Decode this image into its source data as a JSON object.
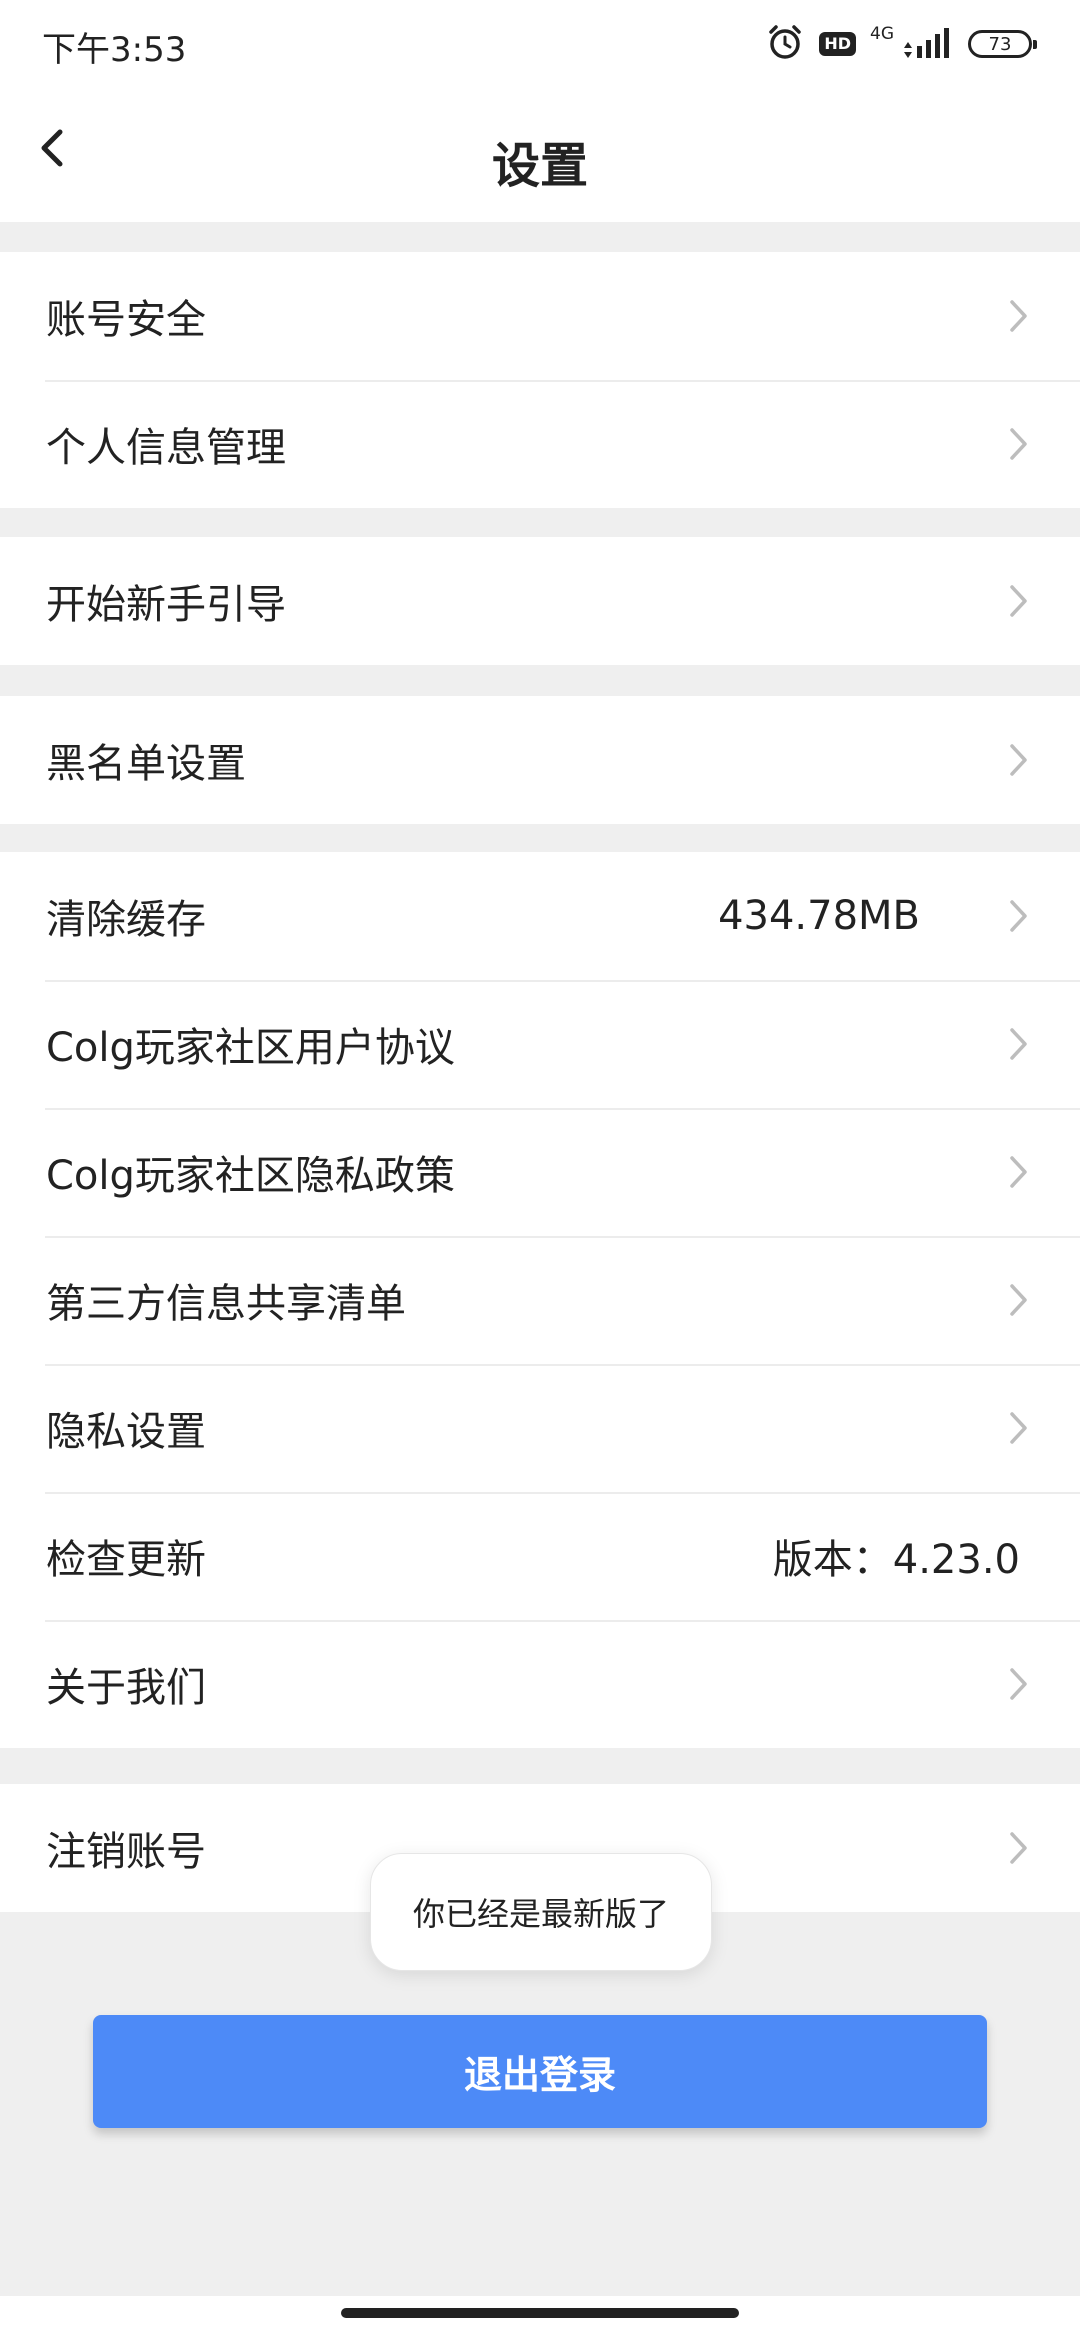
{
  "status_bar": {
    "time": "下午3:53",
    "hd": "HD",
    "network": "4G",
    "battery": "73"
  },
  "nav": {
    "title": "设置"
  },
  "groups": [
    {
      "items": [
        {
          "label": "账号安全"
        },
        {
          "label": "个人信息管理"
        }
      ]
    },
    {
      "items": [
        {
          "label": "开始新手引导"
        }
      ]
    },
    {
      "items": [
        {
          "label": "黑名单设置"
        }
      ]
    },
    {
      "items": [
        {
          "label": "清除缓存",
          "value": "434.78MB"
        },
        {
          "label": "Colg玩家社区用户协议"
        },
        {
          "label": "Colg玩家社区隐私政策"
        },
        {
          "label": "第三方信息共享清单"
        },
        {
          "label": "隐私设置"
        },
        {
          "label": "检查更新",
          "value": "版本：4.23.0"
        },
        {
          "label": "关于我们"
        }
      ]
    },
    {
      "items": [
        {
          "label": "注销账号"
        }
      ]
    }
  ],
  "toast": "你已经是最新版了",
  "logout_label": "退出登录",
  "colors": {
    "accent": "#4d8af7",
    "background": "#efefef",
    "chevron": "#bdbdbd"
  }
}
